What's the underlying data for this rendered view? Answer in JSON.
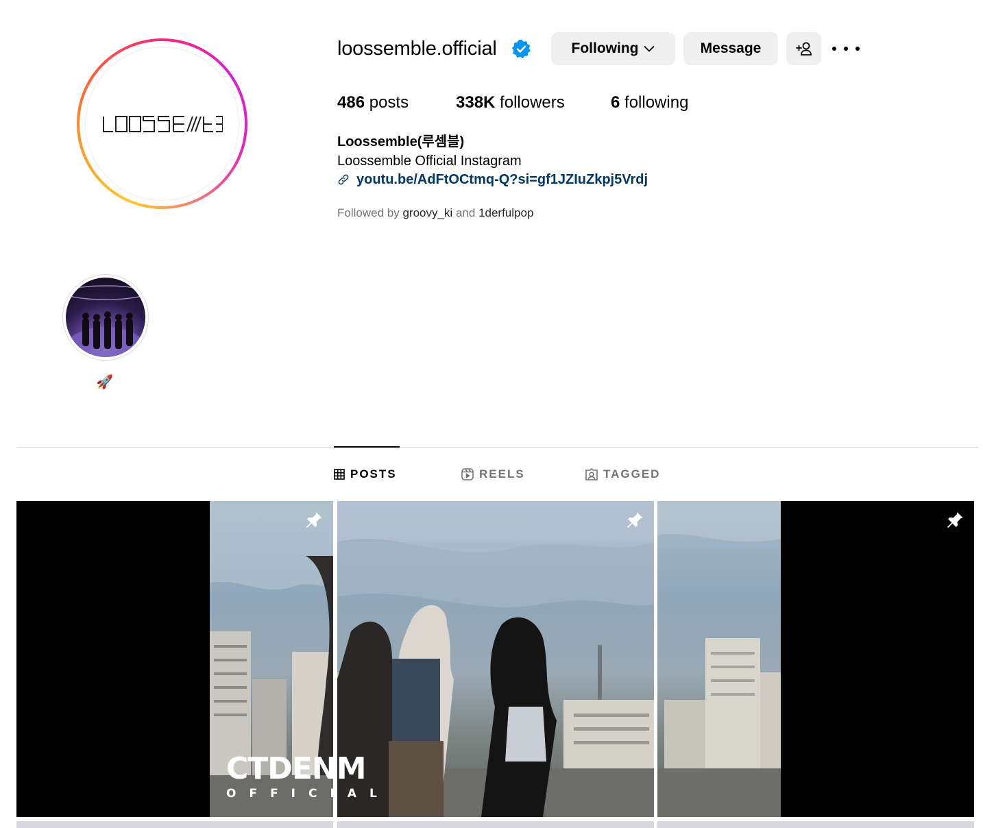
{
  "profile": {
    "username": "loossemble.official",
    "verified_icon": "verified-badge-icon",
    "logo_text": "LOOSSEMBLE",
    "buttons": {
      "following": "Following",
      "message": "Message",
      "add_user_icon": "add-user-icon",
      "more_icon": "more-options-icon"
    },
    "stats": {
      "posts_count": "486",
      "posts_label": "posts",
      "followers_count": "338K",
      "followers_label": "followers",
      "following_count": "6",
      "following_label": "following"
    },
    "full_name": "Loossemble(루셈블)",
    "bio": "Loossemble Official Instagram",
    "link": "youtu.be/AdFtOCtmq-Q?si=gf1JZIuZkpj5Vrdj",
    "followed_by": {
      "prefix": "Followed by",
      "user1": "groovy_ki",
      "conj": "and",
      "user2": "1derfulpop"
    }
  },
  "highlights": [
    {
      "label": "🚀"
    }
  ],
  "tabs": [
    {
      "label": "POSTS",
      "icon": "grid-icon",
      "active": true
    },
    {
      "label": "REELS",
      "icon": "reels-icon",
      "active": false
    },
    {
      "label": "TAGGED",
      "icon": "tagged-icon",
      "active": false
    }
  ],
  "posts": [
    {
      "pinned": true,
      "overlay_main": "CTDENM",
      "overlay_sub": "OFFICIAL"
    },
    {
      "pinned": true
    },
    {
      "pinned": true
    }
  ],
  "colors": {
    "link": "#00376b",
    "button_bg": "#efefef",
    "verified": "#0095f6",
    "muted_text": "#737373"
  }
}
